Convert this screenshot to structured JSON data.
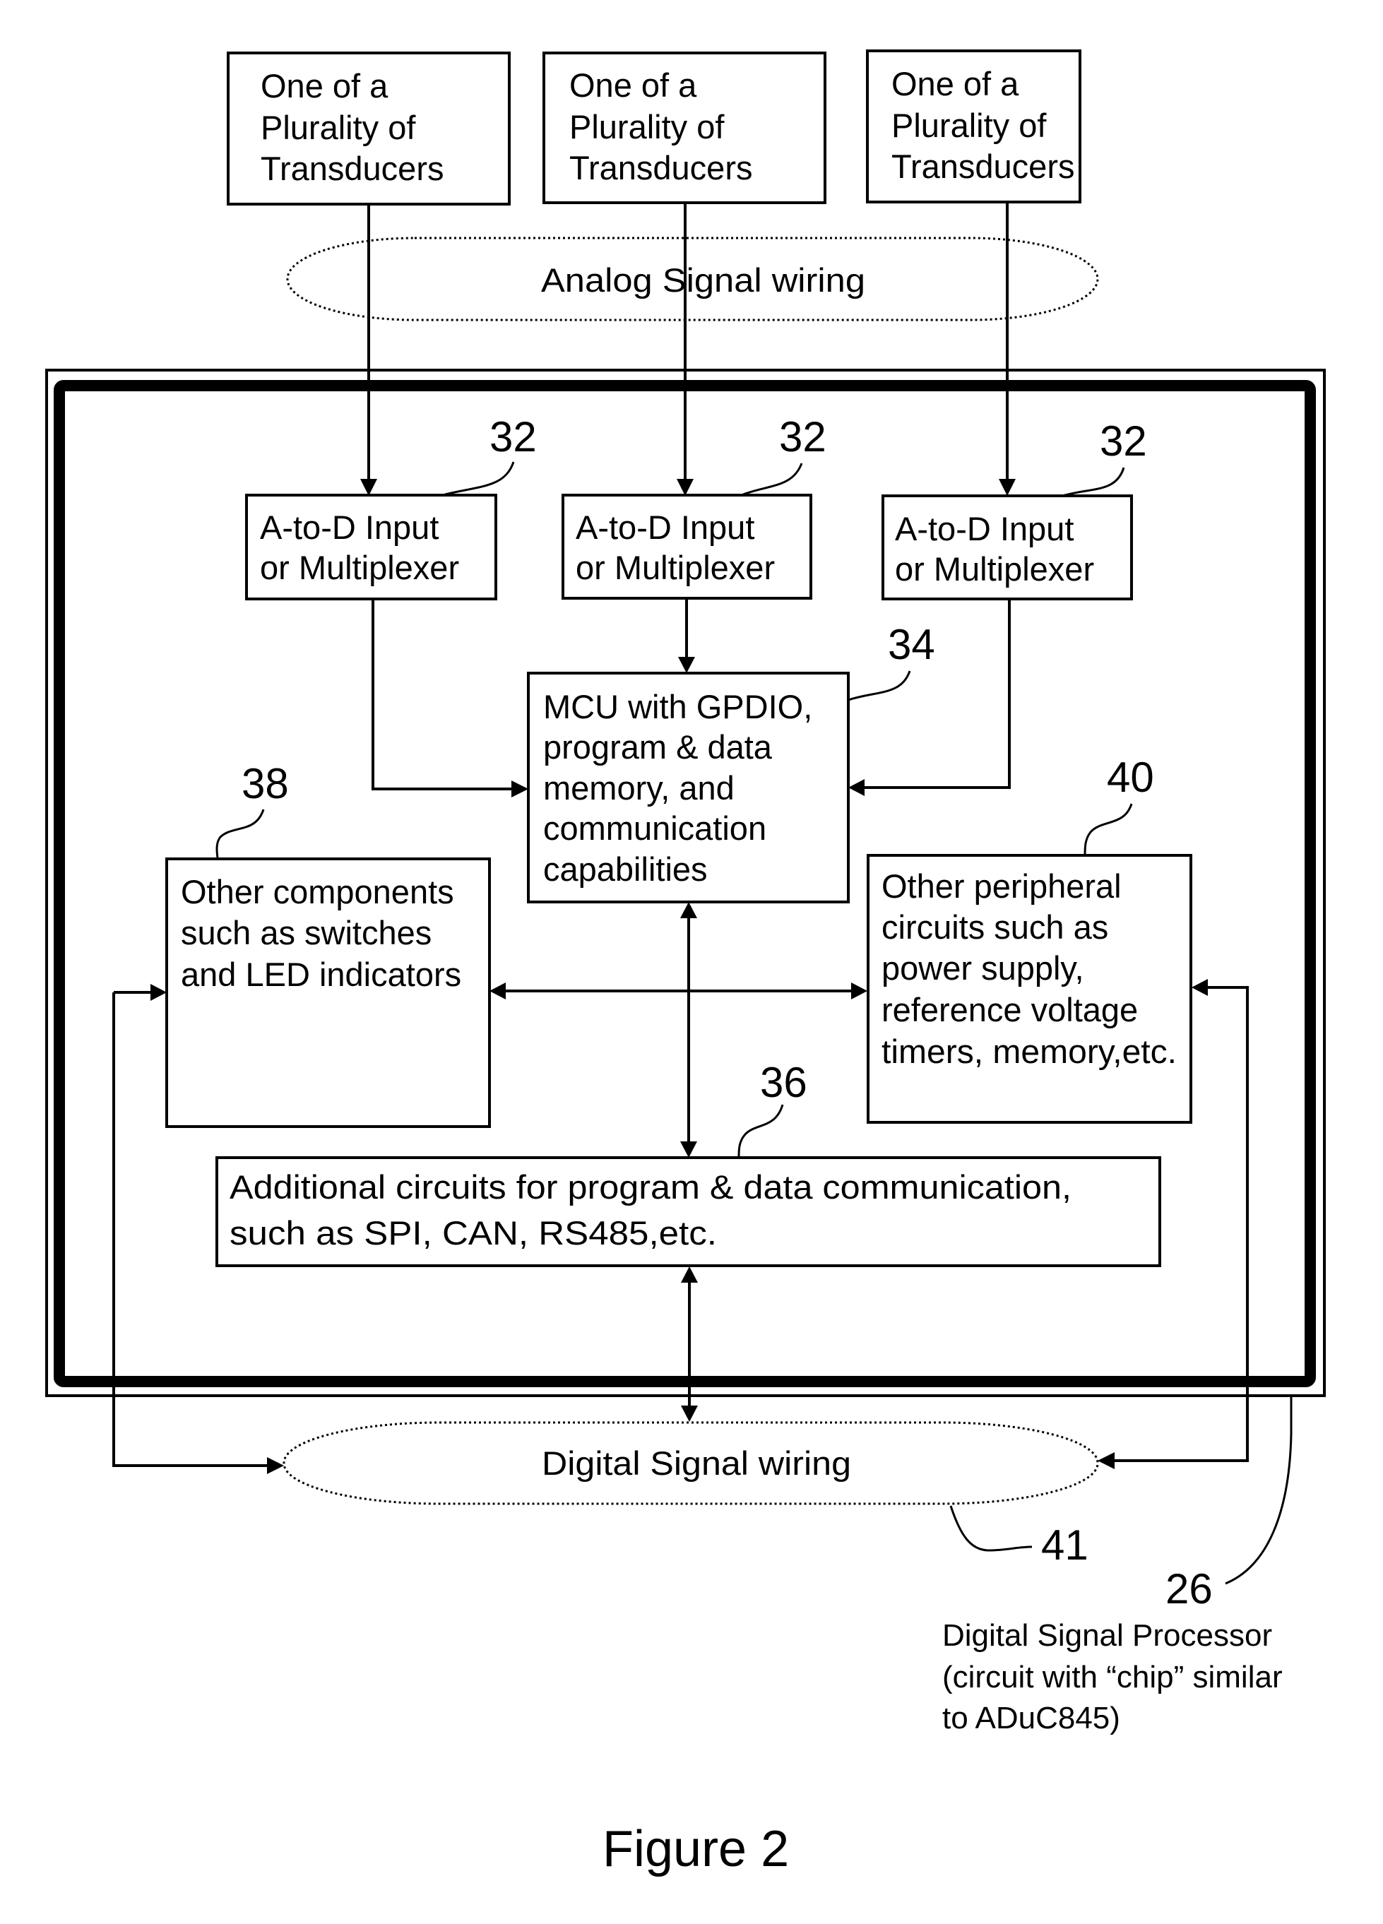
{
  "figure": {
    "caption": "Figure 2"
  },
  "transducers": [
    {
      "lines": [
        "One of a",
        "Plurality of",
        "Transducers"
      ]
    },
    {
      "lines": [
        "One of a",
        "Plurality of",
        "Transducers"
      ]
    },
    {
      "lines": [
        "One of a",
        "Plurality of",
        "Transducers"
      ]
    }
  ],
  "analog_wiring": {
    "label": "Analog Signal wiring"
  },
  "adc_blocks": [
    {
      "ref": "32",
      "lines": [
        "A-to-D Input",
        "or Multiplexer"
      ]
    },
    {
      "ref": "32",
      "lines": [
        "A-to-D Input",
        "or Multiplexer"
      ]
    },
    {
      "ref": "32",
      "lines": [
        "A-to-D Input",
        "or Multiplexer"
      ]
    }
  ],
  "mcu": {
    "ref": "34",
    "lines": [
      "MCU with GPDIO,",
      "program & data",
      "memory, and",
      "communication",
      "capabilities"
    ]
  },
  "other_components": {
    "ref": "38",
    "lines": [
      "Other components",
      "such as switches",
      "and LED indicators"
    ]
  },
  "peripherals": {
    "ref": "40",
    "lines": [
      "Other peripheral",
      "circuits such as",
      "power supply,",
      "reference voltage",
      "timers, memory,etc."
    ]
  },
  "comm_circuits": {
    "ref": "36",
    "lines": [
      "Additional circuits for program & data communication,",
      "such as SPI, CAN, RS485,etc."
    ]
  },
  "digital_wiring": {
    "label": "Digital Signal wiring",
    "ref": "41"
  },
  "dsp": {
    "ref": "26",
    "lines": [
      "Digital Signal Processor",
      "(circuit with “chip” similar",
      "to ADuC845)"
    ]
  }
}
